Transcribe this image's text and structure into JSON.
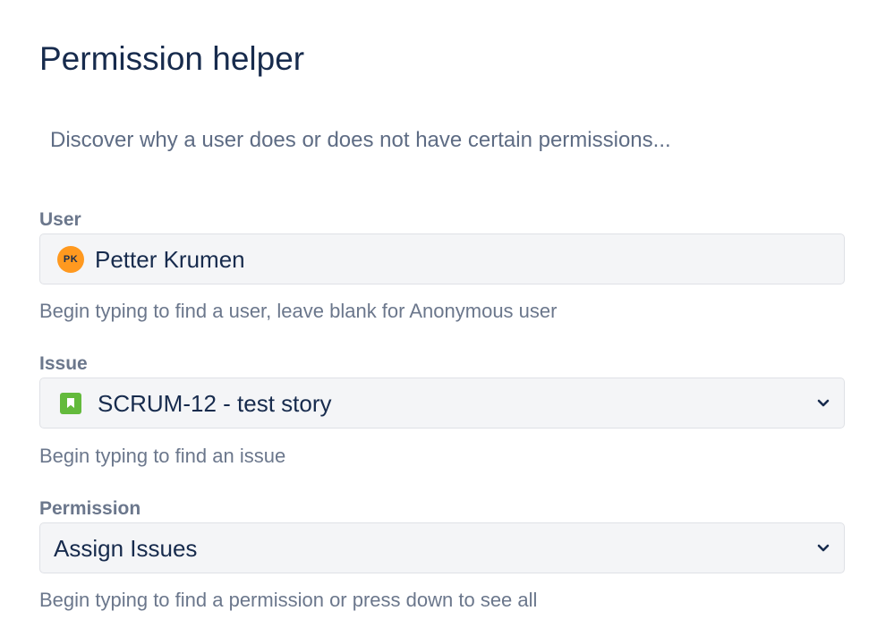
{
  "page": {
    "title": "Permission helper",
    "intro": "Discover why a user does or does not have certain permissions..."
  },
  "user_field": {
    "label": "User",
    "avatar_initials": "PK",
    "avatar_color": "#ff991f",
    "value": "Petter Krumen",
    "helper": "Begin typing to find a user, leave blank for Anonymous user"
  },
  "issue_field": {
    "label": "Issue",
    "icon": "story-icon",
    "icon_color": "#63ba3c",
    "value": "SCRUM-12 - test story",
    "helper": "Begin typing to find an issue"
  },
  "permission_field": {
    "label": "Permission",
    "value": "Assign Issues",
    "helper": "Begin typing to find a permission or press down to see all"
  }
}
